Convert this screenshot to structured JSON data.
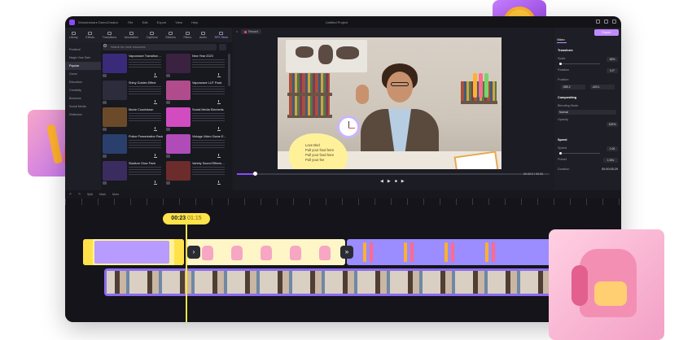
{
  "app": {
    "name": "Wondershare DemoCreator",
    "menu": [
      "File",
      "Edit",
      "Export",
      "View",
      "Help"
    ],
    "project_title": "Untitled Project"
  },
  "toolbar": [
    {
      "label": "Library",
      "icon": "library-icon"
    },
    {
      "label": "Effects",
      "icon": "effects-icon"
    },
    {
      "label": "Transitions",
      "icon": "transitions-icon"
    },
    {
      "label": "Annotation",
      "icon": "annotation-icon"
    },
    {
      "label": "Captions",
      "icon": "captions-icon"
    },
    {
      "label": "Stickers",
      "icon": "stickers-icon"
    },
    {
      "label": "Filters",
      "icon": "filters-icon"
    },
    {
      "label": "Audio",
      "icon": "audio-icon"
    },
    {
      "label": "SFX Store",
      "icon": "store-icon",
      "active": true
    }
  ],
  "sidebar": [
    "Practical",
    "Magic Year Sale",
    "Popular",
    "Game",
    "Education",
    "Creativity",
    "Business",
    "Social Media",
    "Reflection"
  ],
  "library": {
    "search_placeholder": "Search for more resources",
    "cards": [
      {
        "name": "Vaporwave Transition ...",
        "color": "#3a2a7a"
      },
      {
        "name": "New Year 2023",
        "color": "#3b2240"
      },
      {
        "name": "Shiny Golden Effect",
        "color": "#2c2c3c"
      },
      {
        "name": "Vaporwave LUT Pack",
        "color": "#b04c8c"
      },
      {
        "name": "Movie Countdown",
        "color": "#6b4a2a"
      },
      {
        "name": "Social Media Elements",
        "color": "#d04cc0"
      },
      {
        "name": "Police Presentation Pack",
        "color": "#2a3f6c"
      },
      {
        "name": "Vintage Video Game E...",
        "color": "#b04cb8"
      },
      {
        "name": "Stadium Glow Pack",
        "color": "#3b2c60"
      },
      {
        "name": "Variety Sound Effects ...",
        "color": "#6c2c2c"
      }
    ]
  },
  "preview": {
    "record_label": "Record",
    "bubble_lines": [
      "Love Bird",
      "Pull your food here",
      "Pull your food here",
      "Pull your fee"
    ],
    "timecode": "00:00:0 / 00:00"
  },
  "properties": {
    "export_label": "Export",
    "tab": "Video",
    "transform": "Transform",
    "scale": {
      "label": "Scale",
      "value": "48%"
    },
    "rotation": {
      "label": "Rotation",
      "value": "0.0°"
    },
    "position": {
      "label": "Position",
      "x": "-985.2",
      "y": "-403.1"
    },
    "compositing": "Compositing",
    "blending": {
      "label": "Blending Mode",
      "value": "Normal"
    },
    "opacity": {
      "label": "Opacity",
      "value": "100%"
    },
    "speed": "Speed",
    "speed_value": {
      "label": "Speed",
      "value": "1.00"
    },
    "preset": {
      "label": "Preset",
      "value": "1.00x"
    },
    "duration": {
      "label": "Duration",
      "value": "00:00:05:29"
    }
  },
  "timeline": {
    "tools": [
      "Undo",
      "Redo",
      "Split",
      "Mark",
      "More"
    ],
    "playhead_current": "00:23",
    "playhead_total": "01:15"
  },
  "colors": {
    "accent": "#8a4bff",
    "playhead": "#ffe34a",
    "clip_purple": "#9b8cff"
  }
}
